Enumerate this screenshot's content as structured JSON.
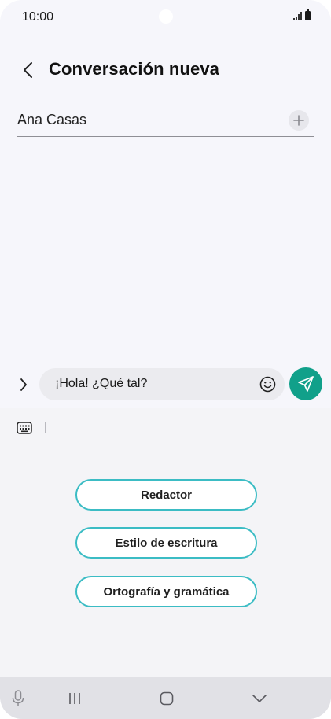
{
  "status_bar": {
    "time": "10:00",
    "icons": [
      "signal-icon",
      "battery-icon"
    ]
  },
  "header": {
    "back_icon": "chevron-left-icon",
    "title": "Conversación nueva"
  },
  "recipient": {
    "value": "Ana Casas",
    "add_icon": "plus-icon"
  },
  "composer": {
    "expand_icon": "chevron-right-icon",
    "message": "¡Hola! ¿Qué tal?",
    "emoji_icon": "smiley-icon",
    "send_icon": "paper-plane-icon",
    "send_color": "#11A08A"
  },
  "assistant_panel": {
    "keyboard_icon": "keyboard-icon",
    "options": [
      "Redactor",
      "Estilo de escritura",
      "Ortografía y gramática"
    ],
    "accent_color": "#3BBCC4"
  },
  "nav_bar": {
    "icons": [
      "microphone-icon",
      "recents-icon",
      "home-icon",
      "hide-keyboard-icon"
    ]
  }
}
